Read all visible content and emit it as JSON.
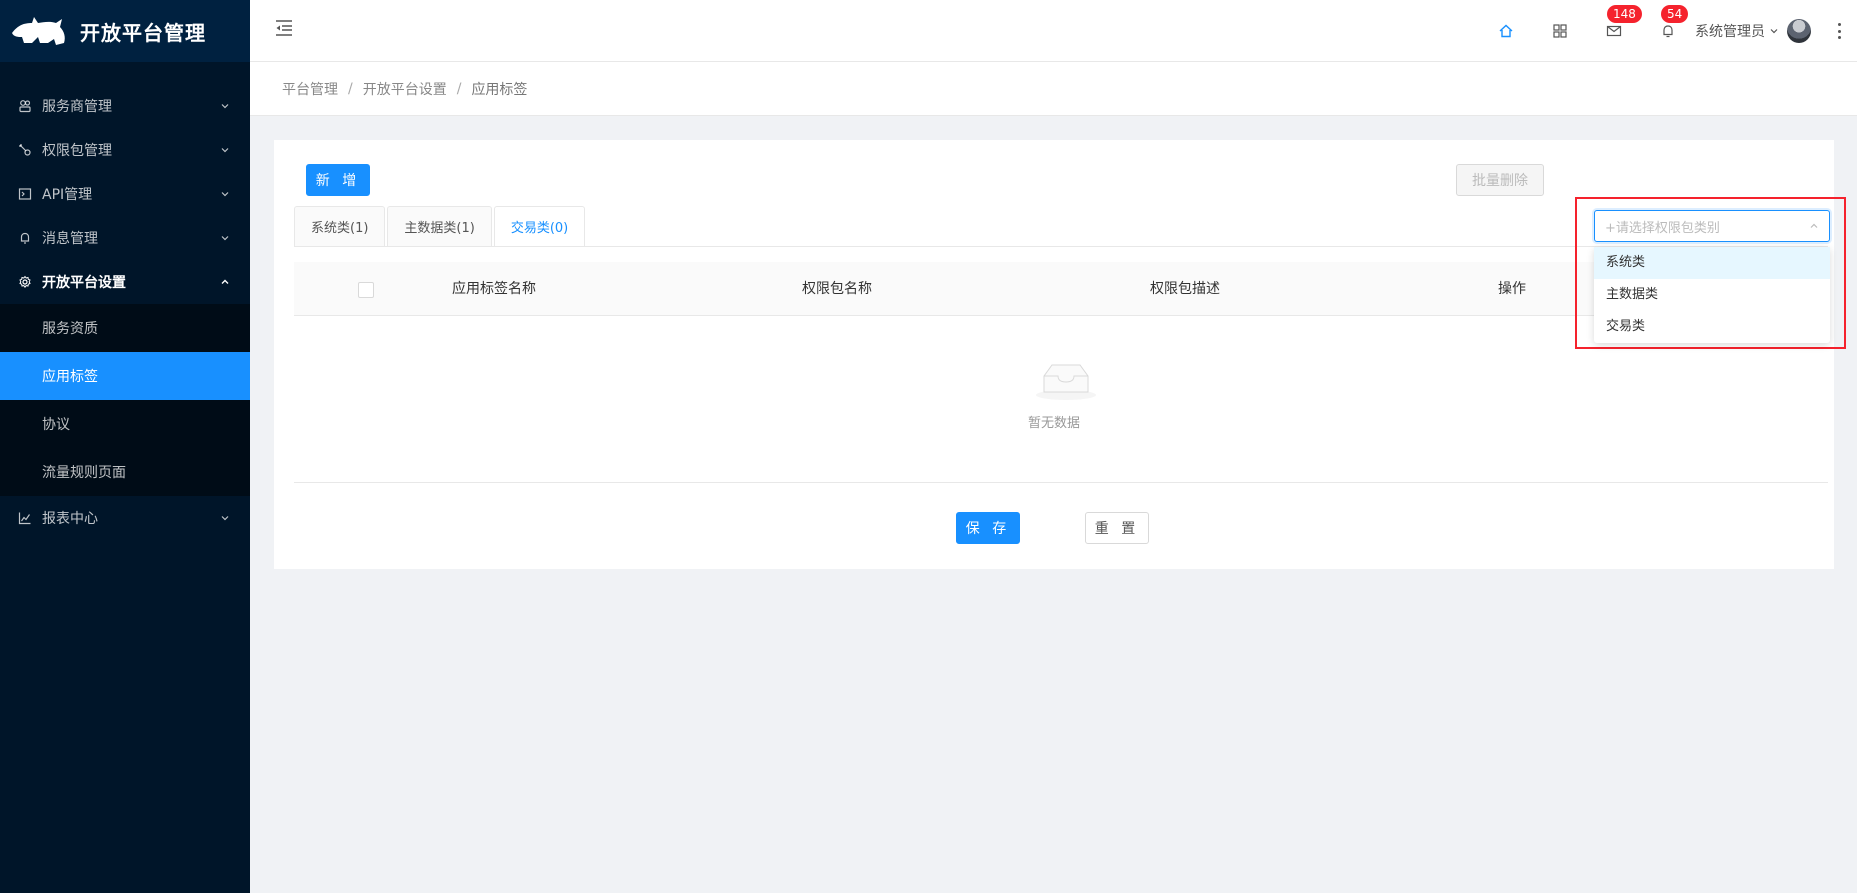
{
  "brand": {
    "title": "开放平台管理",
    "logo_icon": "rhino-logo-icon"
  },
  "sidebar": {
    "items": [
      {
        "label": "服务商管理",
        "icon": "provider-icon"
      },
      {
        "label": "权限包管理",
        "icon": "permission-icon"
      },
      {
        "label": "API管理",
        "icon": "api-icon"
      },
      {
        "label": "消息管理",
        "icon": "bell-icon"
      },
      {
        "label": "开放平台设置",
        "icon": "gear-icon",
        "open": true
      },
      {
        "label": "报表中心",
        "icon": "chart-icon"
      }
    ],
    "submenu": [
      {
        "label": "服务资质"
      },
      {
        "label": "应用标签",
        "active": true
      },
      {
        "label": "协议"
      },
      {
        "label": "流量规则页面"
      }
    ]
  },
  "header": {
    "icons": [
      "home-icon",
      "grid-icon",
      "mail-icon",
      "bell-icon"
    ],
    "mail_badge": "148",
    "bell_badge": "54",
    "user_name": "系统管理员",
    "accent": "#1890ff"
  },
  "breadcrumb": [
    "平台管理",
    "开放平台设置",
    "应用标签"
  ],
  "toolbar": {
    "new_label": "新 增",
    "batch_delete_label": "批量删除"
  },
  "tabs": [
    {
      "label": "系统类(1)"
    },
    {
      "label": "主数据类(1)"
    },
    {
      "label": "交易类(0)",
      "active": true
    }
  ],
  "table": {
    "columns": [
      "应用标签名称",
      "权限包名称",
      "权限包描述",
      "操作"
    ],
    "rows": [],
    "empty_text": "暂无数据"
  },
  "form": {
    "save_label": "保 存",
    "reset_label": "重 置"
  },
  "select": {
    "placeholder": "+请选择权限包类别",
    "options": [
      "系统类",
      "主数据类",
      "交易类"
    ],
    "hovered": "系统类"
  }
}
